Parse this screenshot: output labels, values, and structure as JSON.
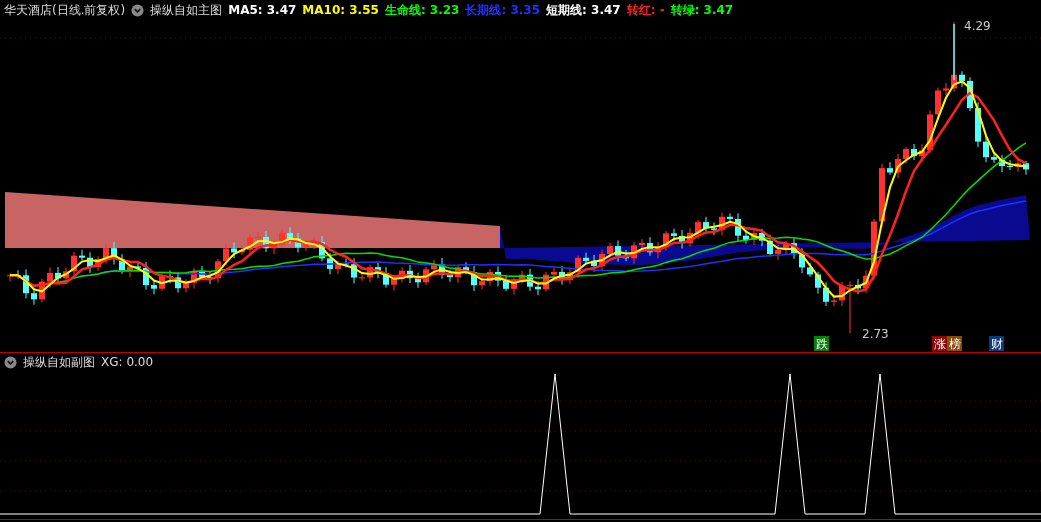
{
  "main_chart": {
    "stock": "华天酒店(日线.前复权)",
    "indicator": "操纵自如主图",
    "values": [
      {
        "label": "MA5:",
        "value": "3.47",
        "color": "#ffffff"
      },
      {
        "label": "MA10:",
        "value": "3.55",
        "color": "#ffff00"
      },
      {
        "label": "生命线:",
        "value": "3.23",
        "color": "#00ff00"
      },
      {
        "label": "长期线:",
        "value": "3.35",
        "color": "#2030ff"
      },
      {
        "label": "短期线:",
        "value": "3.47",
        "color": "#ffffff"
      },
      {
        "label": "转红:",
        "value": "-",
        "color": "#ff2020"
      },
      {
        "label": "转绿:",
        "value": "3.47",
        "color": "#00ff00"
      }
    ],
    "high_label": "4.29",
    "low_label": "2.73",
    "signals": [
      {
        "text": "跌",
        "color": "#0b7d0b"
      },
      {
        "text": "涨",
        "color": "#8a0a0a"
      },
      {
        "text": "榜",
        "color": "#8a4a0c"
      },
      {
        "text": "财",
        "color": "#0c3a78"
      }
    ]
  },
  "sub_chart": {
    "indicator": "操纵自如副图",
    "values": [
      {
        "label": "XG:",
        "value": "0.00"
      }
    ]
  }
}
